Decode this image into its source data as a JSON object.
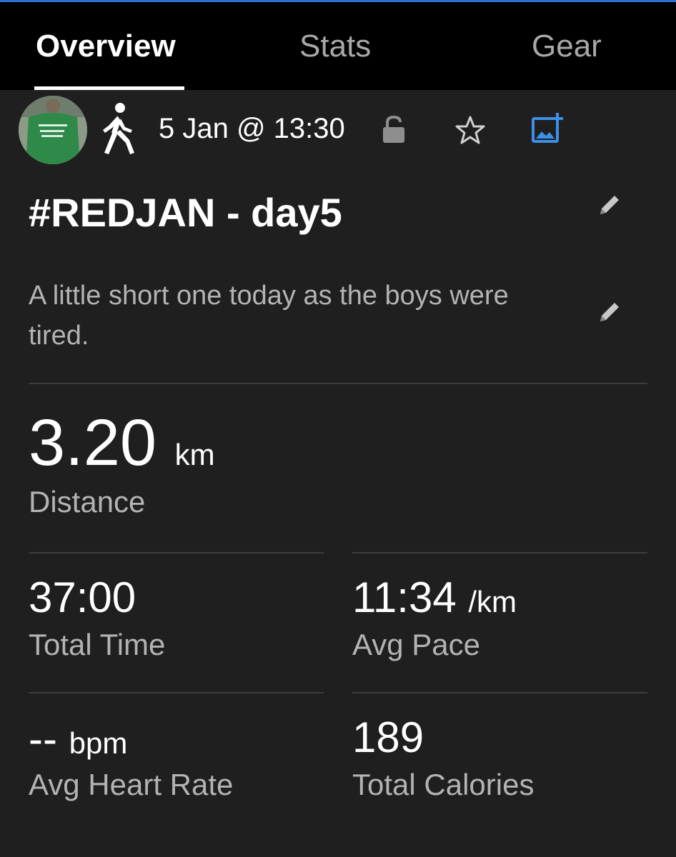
{
  "tabs": [
    {
      "label": "Overview",
      "active": true
    },
    {
      "label": "Stats",
      "active": false
    },
    {
      "label": "Gear",
      "active": false
    }
  ],
  "activity": {
    "type_icon": "walking-person-icon",
    "datetime": "5 Jan @ 13:30",
    "privacy_icon": "unlock-icon",
    "favorite_icon": "star-icon",
    "add_photo_icon": "add-photo-icon",
    "title": "#REDJAN - day5",
    "description": "A little short one today as the boys were tired."
  },
  "stats": {
    "distance": {
      "value": "3.20",
      "unit": "km",
      "label": "Distance"
    },
    "total_time": {
      "value": "37:00",
      "label": "Total Time"
    },
    "avg_pace": {
      "value": "11:34",
      "unit": "/km",
      "label": "Avg Pace"
    },
    "avg_heart_rate": {
      "value": "--",
      "unit": "bpm",
      "label": "Avg Heart Rate"
    },
    "total_calories": {
      "value": "189",
      "label": "Total Calories"
    }
  },
  "colors": {
    "background": "#1f1f1f",
    "tabbar": "#000000",
    "accent_blue": "#3d8fe8",
    "muted_text": "#b3b3b3",
    "divider": "#3d3d3d"
  }
}
